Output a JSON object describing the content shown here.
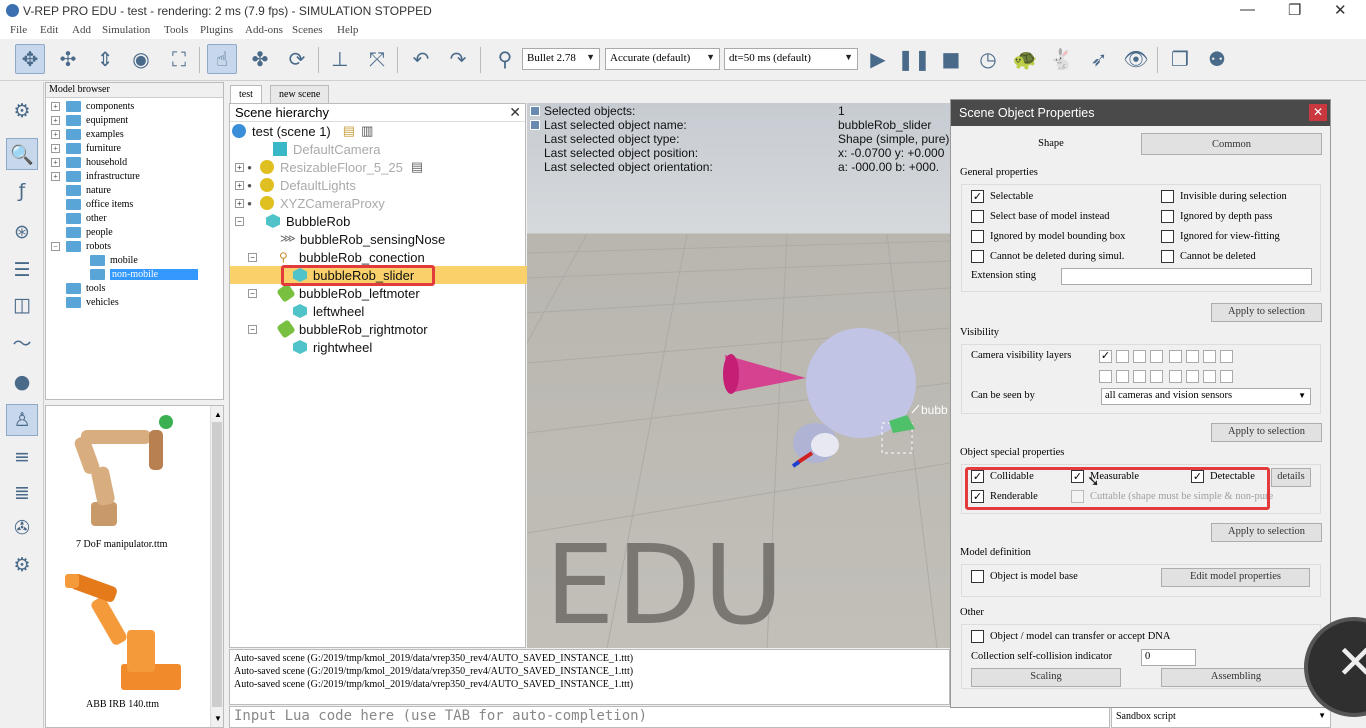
{
  "window": {
    "title": "V-REP PRO EDU - test - rendering: 2 ms (7.9 fps) - SIMULATION STOPPED",
    "controls": [
      "—",
      "❐",
      "✕"
    ]
  },
  "menu": [
    "File",
    "Edit",
    "Add",
    "Simulation",
    "Tools",
    "Plugins",
    "Add-ons",
    "Scenes",
    "Help"
  ],
  "toolbar": {
    "engine": "Bullet 2.78",
    "accuracy": "Accurate (default)",
    "timestep": "dt=50 ms (default)"
  },
  "model_browser": {
    "header": "Model browser",
    "items": [
      {
        "label": "components",
        "expanded": false
      },
      {
        "label": "equipment",
        "expanded": false
      },
      {
        "label": "examples",
        "expanded": false
      },
      {
        "label": "furniture",
        "expanded": false
      },
      {
        "label": "household",
        "expanded": false
      },
      {
        "label": "infrastructure",
        "expanded": false
      },
      {
        "label": "nature",
        "expanded": null
      },
      {
        "label": "office items",
        "expanded": null
      },
      {
        "label": "other",
        "expanded": null
      },
      {
        "label": "people",
        "expanded": null
      },
      {
        "label": "robots",
        "expanded": true
      },
      {
        "label": "mobile",
        "child": true
      },
      {
        "label": "non-mobile",
        "child": true,
        "selected": true
      },
      {
        "label": "tools",
        "expanded": null
      },
      {
        "label": "vehicles",
        "expanded": null
      }
    ]
  },
  "thumbnails": [
    {
      "label": "7 DoF manipulator.ttm"
    },
    {
      "label": "ABB IRB 140.ttm"
    }
  ],
  "scene_tabs": [
    "test",
    "new scene"
  ],
  "hierarchy": {
    "title": "Scene hierarchy",
    "nodes": [
      {
        "label": "test (scene 1)"
      },
      {
        "label": "DefaultCamera"
      },
      {
        "label": "ResizableFloor_5_25"
      },
      {
        "label": "DefaultLights"
      },
      {
        "label": "XYZCameraProxy"
      },
      {
        "label": "BubbleRob"
      },
      {
        "label": "bubbleRob_sensingNose"
      },
      {
        "label": "bubbleRob_conection"
      },
      {
        "label": "bubbleRob_slider"
      },
      {
        "label": "bubbleRob_leftmoter"
      },
      {
        "label": "leftwheel"
      },
      {
        "label": "bubbleRob_rightmotor"
      },
      {
        "label": "rightwheel"
      }
    ]
  },
  "info": {
    "labels": [
      "Selected objects:",
      "Last selected object name:",
      "Last selected object type:",
      "Last selected object position:",
      "Last selected object orientation:"
    ],
    "values": [
      "1",
      "bubbleRob_slider",
      "Shape (simple, pure)",
      "x: -0.0700   y: +0.000",
      "a: -000.00    b: +000."
    ]
  },
  "viewport": {
    "watermark": "EDU",
    "object_label": "bubb"
  },
  "console": [
    "Auto-saved scene (G:/2019/tmp/kmol_2019/data/vrep350_rev4/AUTO_SAVED_INSTANCE_1.ttt)",
    "Auto-saved scene (G:/2019/tmp/kmol_2019/data/vrep350_rev4/AUTO_SAVED_INSTANCE_1.ttt)",
    "Auto-saved scene (G:/2019/tmp/kmol_2019/data/vrep350_rev4/AUTO_SAVED_INSTANCE_1.ttt)"
  ],
  "lua_input": {
    "placeholder": "Input Lua code here (use TAB for auto-completion)"
  },
  "sandbox": "Sandbox script",
  "dialog": {
    "title": "Scene Object Properties",
    "close": "✕",
    "tabs": {
      "shape": "Shape",
      "common": "Common"
    },
    "general": {
      "header": "General properties",
      "selectable": "Selectable",
      "invisible": "Invisible during selection",
      "select_base": "Select base of model instead",
      "ignored_depth": "Ignored by depth pass",
      "ignored_bbox": "Ignored by model bounding  box",
      "ignored_view": "Ignored for view-fitting",
      "no_delete_sim": "Cannot be deleted during simul.",
      "no_delete": "Cannot be deleted",
      "ext_label": "Extension sting",
      "ext_value": "",
      "apply": "Apply to selection"
    },
    "visibility": {
      "header": "Visibility",
      "layers_label": "Camera visibility layers",
      "seen_label": "Can be seen by",
      "seen_value": "all cameras and vision sensors",
      "apply": "Apply to selection"
    },
    "special": {
      "header": "Object special properties",
      "collidable": "Collidable",
      "measurable": "Measurable",
      "detectable": "Detectable",
      "details": "details",
      "renderable": "Renderable",
      "cuttable": "Cuttable (shape must be simple & non-pure",
      "apply": "Apply to selection"
    },
    "model": {
      "header": "Model definition",
      "is_base": "Object is model base",
      "edit": "Edit model properties"
    },
    "other": {
      "header": "Other",
      "dna": "Object / model can transfer or accept DNA",
      "collision_label": "Collection self-collision indicator",
      "collision_value": "0",
      "scaling": "Scaling",
      "assembling": "Assembling"
    }
  },
  "colors": {
    "accent_red": "#e23b3b",
    "selection_yellow": "#fad06b",
    "dialog_title": "#4a4a4a",
    "folder": "#5aa5d8"
  },
  "icons": [
    "move-icon",
    "pan-icon",
    "play-icon",
    "pause-icon",
    "stop-icon",
    "eye-icon",
    "rocket-icon",
    "turtle-icon",
    "rabbit-icon",
    "camera-icon"
  ]
}
